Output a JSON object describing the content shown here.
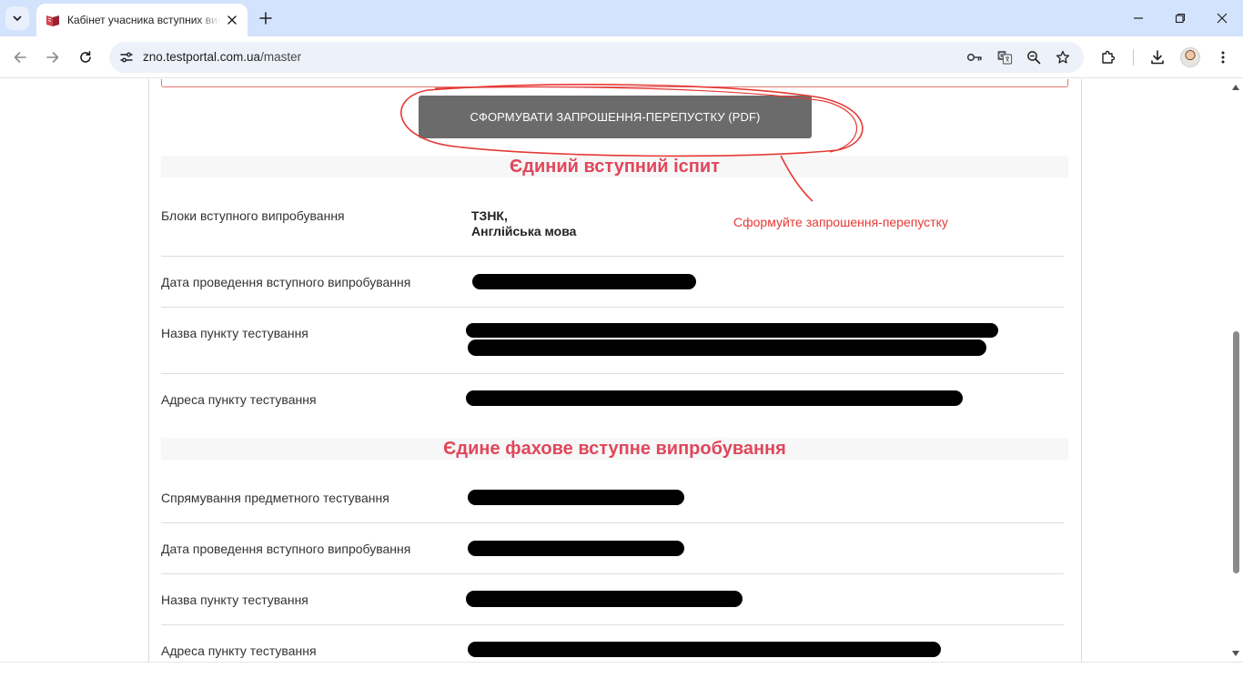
{
  "browser": {
    "tab_title": "Кабінет учасника вступних випробувань",
    "url_host": "zno.testportal.com.ua",
    "url_path": "/master"
  },
  "page": {
    "pdf_button_label": "СФОРМУВАТИ ЗАПРОШЕННЯ-ПЕРЕПУСТКУ (PDF)",
    "annotation_text": "Сформуйте запрошення-перепустку",
    "section1": {
      "title": "Єдиний вступний іспит",
      "rows": [
        {
          "label": "Блоки вступного випробування",
          "value_lines": [
            "ТЗНК,",
            "Англійська мова"
          ]
        },
        {
          "label": "Дата проведення вступного випробування"
        },
        {
          "label": "Назва пункту тестування"
        },
        {
          "label": "Адреса пункту тестування"
        }
      ]
    },
    "section2": {
      "title": "Єдине фахове вступне випробування",
      "rows": [
        {
          "label": "Спрямування предметного тестування"
        },
        {
          "label": "Дата проведення вступного випробування"
        },
        {
          "label": "Назва пункту тестування"
        },
        {
          "label": "Адреса пункту тестування"
        }
      ]
    }
  },
  "colors": {
    "accent_red": "#e0475b",
    "annotation_red": "#e53935",
    "button_gray": "#6b6b6b"
  }
}
